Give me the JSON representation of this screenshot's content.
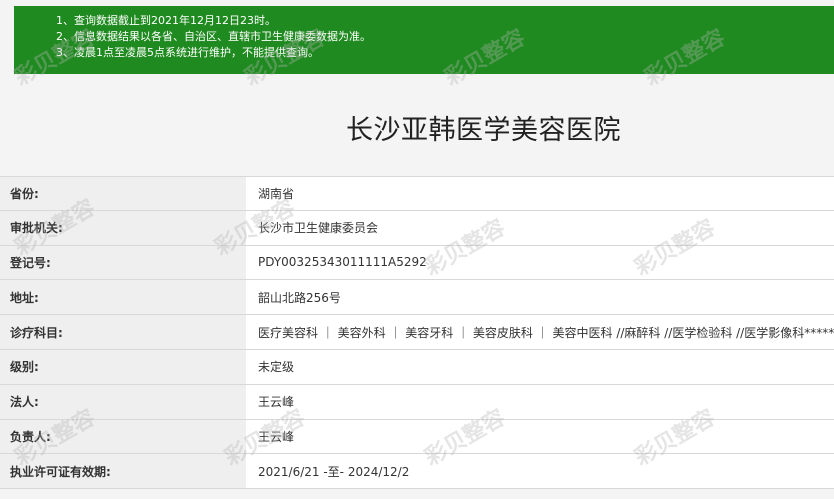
{
  "notice": {
    "lines": [
      "1、查询数据截止到2021年12月12日23时。",
      "2、信息数据结果以各省、自治区、直辖市卫生健康委数据为准。",
      "3、凌晨1点至凌晨5点系统进行维护，不能提供查询。"
    ]
  },
  "hospital": {
    "title": "长沙亚韩医学美容医院"
  },
  "rows": [
    {
      "label": "省份:",
      "value": "湖南省"
    },
    {
      "label": "审批机关:",
      "value": "长沙市卫生健康委员会"
    },
    {
      "label": "登记号:",
      "value": "PDY00325343011111A5292"
    },
    {
      "label": "地址:",
      "value": "韶山北路256号"
    },
    {
      "label": "诊疗科目:",
      "value": "医疗美容科 ｜ 美容外科 ｜ 美容牙科 ｜ 美容皮肤科 ｜ 美容中医科 //麻醉科 //医学检验科 //医学影像科******"
    },
    {
      "label": "级别:",
      "value": "未定级"
    },
    {
      "label": "法人:",
      "value": "王云峰"
    },
    {
      "label": "负责人:",
      "value": "王云峰"
    },
    {
      "label": "执业许可证有效期:",
      "value": "2021/6/21 -至- 2024/12/2"
    }
  ],
  "watermark": {
    "text": "彩贝整容"
  }
}
